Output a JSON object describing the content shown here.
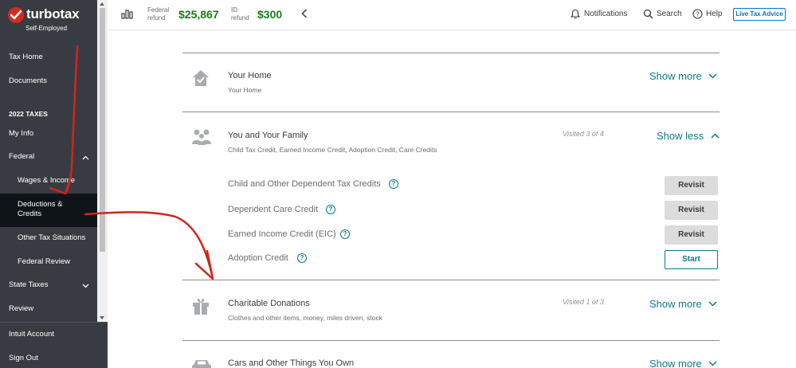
{
  "brand": {
    "name": "turbotax",
    "edition": "Self-Employed",
    "accent": "#d52b1e"
  },
  "sidebar": {
    "items": [
      {
        "label": "Tax Home"
      },
      {
        "label": "Documents"
      },
      {
        "label": "2022 TAXES"
      },
      {
        "label": "My Info"
      },
      {
        "label": "Federal",
        "chevron": "chevron-up"
      },
      {
        "label": "Wages & Income"
      },
      {
        "label": "Deductions &"
      },
      {
        "label": "Credits"
      },
      {
        "label": "Other Tax Situations"
      },
      {
        "label": "Federal Review"
      },
      {
        "label": "State Taxes",
        "chevron": "chevron-down"
      },
      {
        "label": "Review"
      }
    ],
    "footer": [
      {
        "label": "Intuit Account"
      },
      {
        "label": "Sign Out"
      }
    ]
  },
  "topbar": {
    "federal_label_1": "Federal",
    "federal_label_2": "refund",
    "federal_amount": "$25,867",
    "state_label_1": "ID",
    "state_label_2": "refund",
    "state_amount": "$300",
    "notifications": "Notifications",
    "search": "Search",
    "help": "Help",
    "live_advice": "Live Tax Advice"
  },
  "sections": [
    {
      "title": "Your Home",
      "subtitle": "Your Home",
      "toggle": "Show more",
      "icon": "house-icon"
    },
    {
      "title": "You and Your Family",
      "subtitle": "Child Tax Credit, Earned Income Credit, Adoption Credit, Care Credits",
      "visited": "Visited 3 of 4",
      "toggle": "Show less",
      "icon": "family-icon",
      "credits": [
        {
          "label": "Child and Other Dependent Tax Credits",
          "action": "Revisit"
        },
        {
          "label": "Dependent Care Credit",
          "action": "Revisit"
        },
        {
          "label": "Earned Income Credit (EIC)",
          "action": "Revisit"
        },
        {
          "label": "Adoption Credit",
          "action": "Start"
        }
      ]
    },
    {
      "title": "Charitable Donations",
      "subtitle": "Clothes and other items, money, miles driven, stock",
      "visited": "Visited 1 of 3",
      "toggle": "Show more",
      "icon": "gift-icon"
    },
    {
      "title": "Cars and Other Things You Own",
      "toggle": "Show more",
      "icon": "car-icon"
    }
  ],
  "help_glyph": "?",
  "colors": {
    "sidebar_bg": "#383c42",
    "active_bg": "#0f1419",
    "refund_green": "#1a7b18",
    "teal_link": "#0d7b88",
    "annotation_red": "#d0251d"
  }
}
